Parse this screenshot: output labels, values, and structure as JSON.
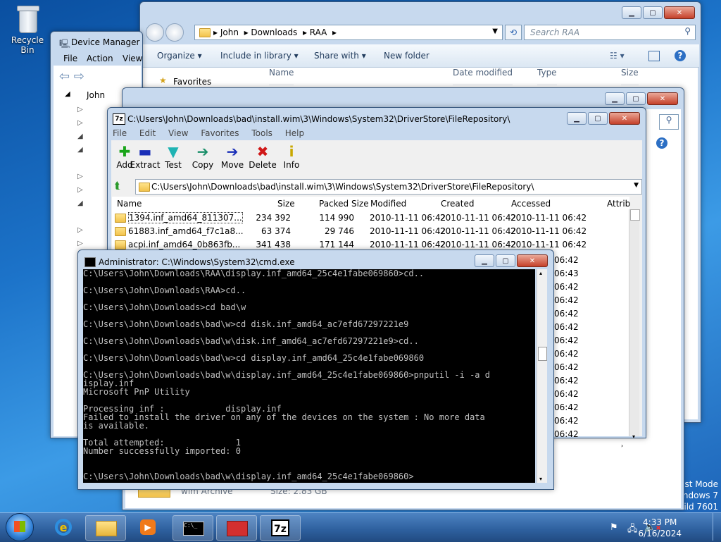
{
  "desktop": {
    "recycle_bin": "Recycle Bin",
    "watermark": [
      "est Mode",
      "indows 7",
      "uild 7601"
    ]
  },
  "explorer": {
    "breadcrumb": [
      "John",
      "Downloads",
      "RAA"
    ],
    "search_placeholder": "Search RAA",
    "toolbar": [
      "Organize",
      "Include in library",
      "Share with",
      "New folder"
    ],
    "nav_favorites": "Favorites",
    "columns": [
      "Name",
      "Date modified",
      "Type",
      "Size"
    ],
    "status_item": "wim Archive",
    "status_size": "Size: 2.83 GB"
  },
  "device_manager": {
    "title": "Device Manager",
    "menu": [
      "File",
      "Action",
      "View"
    ],
    "root": "John"
  },
  "sevenzip": {
    "title": "C:\\Users\\John\\Downloads\\bad\\install.wim\\3\\Windows\\System32\\DriverStore\\FileRepository\\",
    "menu": [
      "File",
      "Edit",
      "View",
      "Favorites",
      "Tools",
      "Help"
    ],
    "tools": [
      {
        "label": "Add",
        "icon": "add-icon",
        "color": "#1aa51a",
        "glyph": "✚"
      },
      {
        "label": "Extract",
        "icon": "extract-icon",
        "color": "#1a2fb8",
        "glyph": "▬"
      },
      {
        "label": "Test",
        "icon": "test-icon",
        "color": "#1fb3b3",
        "glyph": "▼"
      },
      {
        "label": "Copy",
        "icon": "copy-icon",
        "color": "#1a8f6a",
        "glyph": "➔"
      },
      {
        "label": "Move",
        "icon": "move-icon",
        "color": "#1a2fb8",
        "glyph": "➔"
      },
      {
        "label": "Delete",
        "icon": "delete-icon",
        "color": "#d01818",
        "glyph": "✖"
      },
      {
        "label": "Info",
        "icon": "info-icon",
        "color": "#c9a800",
        "glyph": "i"
      }
    ],
    "address": "C:\\Users\\John\\Downloads\\bad\\install.wim\\3\\Windows\\System32\\DriverStore\\FileRepository\\",
    "columns": [
      "Name",
      "Size",
      "Packed Size",
      "Modified",
      "Created",
      "Accessed",
      "Attrib"
    ],
    "rows": [
      {
        "name": "1394.inf_amd64_811307...",
        "size": "234 392",
        "packed": "114 990",
        "modified": "2010-11-11 06:42",
        "created": "2010-11-11 06:42",
        "accessed": "2010-11-11 06:42"
      },
      {
        "name": "61883.inf_amd64_f7c1a8...",
        "size": "63 374",
        "packed": "29 746",
        "modified": "2010-11-11 06:42",
        "created": "2010-11-11 06:42",
        "accessed": "2010-11-11 06:42"
      },
      {
        "name": "acpi.inf_amd64_0b863fb...",
        "size": "341 438",
        "packed": "171 144",
        "modified": "2010-11-11 06:42",
        "created": "2010-11-11 06:42",
        "accessed": "2010-11-11 06:42"
      }
    ],
    "accessed_tail": [
      "06:42",
      "06:43",
      "06:42",
      "06:42",
      "06:42",
      "06:42",
      "06:42",
      "06:42",
      "06:42",
      "06:42",
      "06:42",
      "06:42",
      "06:42",
      "06:42"
    ]
  },
  "cmd": {
    "title": "Administrator: C:\\Windows\\System32\\cmd.exe",
    "lines": [
      "C:\\Users\\John\\Downloads\\RAA\\display.inf_amd64_25c4e1fabe069860>cd..",
      "",
      "C:\\Users\\John\\Downloads\\RAA>cd..",
      "",
      "C:\\Users\\John\\Downloads>cd bad\\w",
      "",
      "C:\\Users\\John\\Downloads\\bad\\w>cd disk.inf_amd64_ac7efd67297221e9",
      "",
      "C:\\Users\\John\\Downloads\\bad\\w\\disk.inf_amd64_ac7efd67297221e9>cd..",
      "",
      "C:\\Users\\John\\Downloads\\bad\\w>cd display.inf_amd64_25c4e1fabe069860",
      "",
      "C:\\Users\\John\\Downloads\\bad\\w\\display.inf_amd64_25c4e1fabe069860>pnputil -i -a d",
      "isplay.inf",
      "Microsoft PnP Utility",
      "",
      "Processing inf :            display.inf",
      "Failed to install the driver on any of the devices on the system : No more data",
      "is available.",
      "",
      "Total attempted:              1",
      "Number successfully imported: 0",
      "",
      "",
      "C:\\Users\\John\\Downloads\\bad\\w\\display.inf_amd64_25c4e1fabe069860>"
    ]
  },
  "taskbar": {
    "time": "4:33 PM",
    "date": "6/16/2024"
  }
}
